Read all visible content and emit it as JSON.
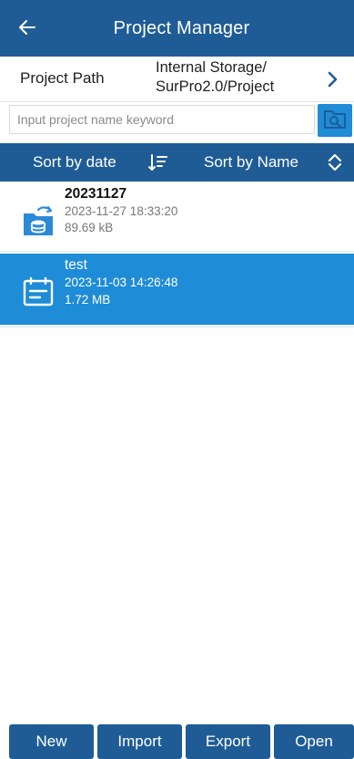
{
  "header": {
    "title": "Project Manager",
    "back_icon": "arrow-left-icon"
  },
  "path": {
    "label": "Project Path",
    "value_line1": "Internal Storage/",
    "value_line2": "SurPro2.0/Project",
    "chevron_icon": "chevron-right-icon"
  },
  "search": {
    "placeholder": "Input project name keyword",
    "value": "",
    "icon": "folder-search-icon"
  },
  "sort": {
    "by_date_label": "Sort by date",
    "by_date_icon": "sort-descending-icon",
    "by_name_label": "Sort by Name",
    "by_name_icon": "sort-updown-icon"
  },
  "projects": [
    {
      "name": "20231127",
      "date": "2023-11-27 18:33:20",
      "size": "89.69 kB",
      "icon": "folder-database-icon",
      "selected": false
    },
    {
      "name": "test",
      "date": "2023-11-03 14:26:48",
      "size": "1.72 MB",
      "icon": "clipboard-icon",
      "selected": true
    }
  ],
  "buttons": {
    "new": "New",
    "import": "Import",
    "export": "Export",
    "open": "Open"
  },
  "colors": {
    "primary": "#1f5c96",
    "selected": "#1e8cd6",
    "accent": "#1e8cd6"
  }
}
